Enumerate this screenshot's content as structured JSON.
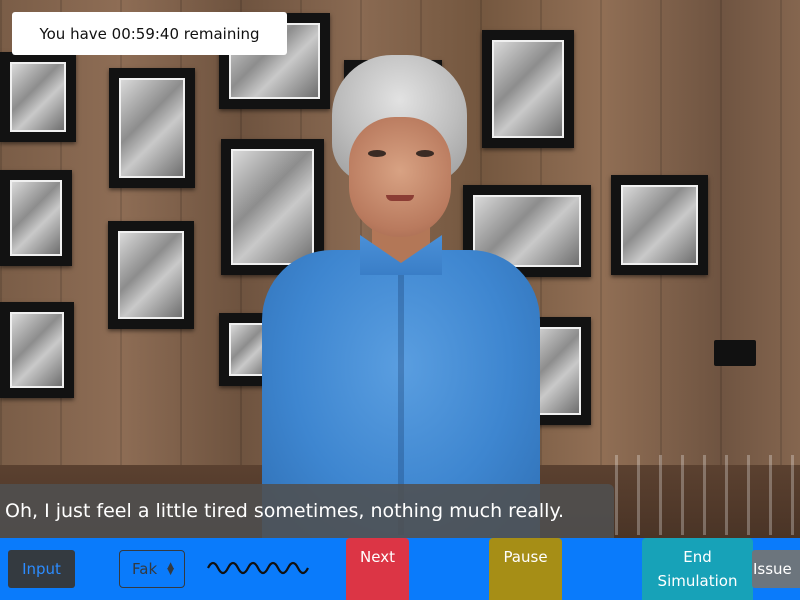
{
  "timer": {
    "text": "You have 00:59:40 remaining"
  },
  "subtitle": {
    "text": "Oh, I just feel a little tired sometimes, nothing much really."
  },
  "toolbar": {
    "input_label": "Input",
    "select_value": "Fak",
    "next_label": "Next",
    "pause_label": "Pause",
    "end_label_line1": "End",
    "end_label_line2": "Simulation",
    "issue_label": "Issue"
  },
  "colors": {
    "toolbar_bg": "#0a7bfb",
    "next": "#dc3545",
    "pause": "#a68e16",
    "end": "#17a2b8",
    "issue": "#6c757d",
    "input": "#343a40"
  },
  "icons": {
    "select_caret": "sort-arrows-icon",
    "audio": "audio-waveform-icon"
  }
}
